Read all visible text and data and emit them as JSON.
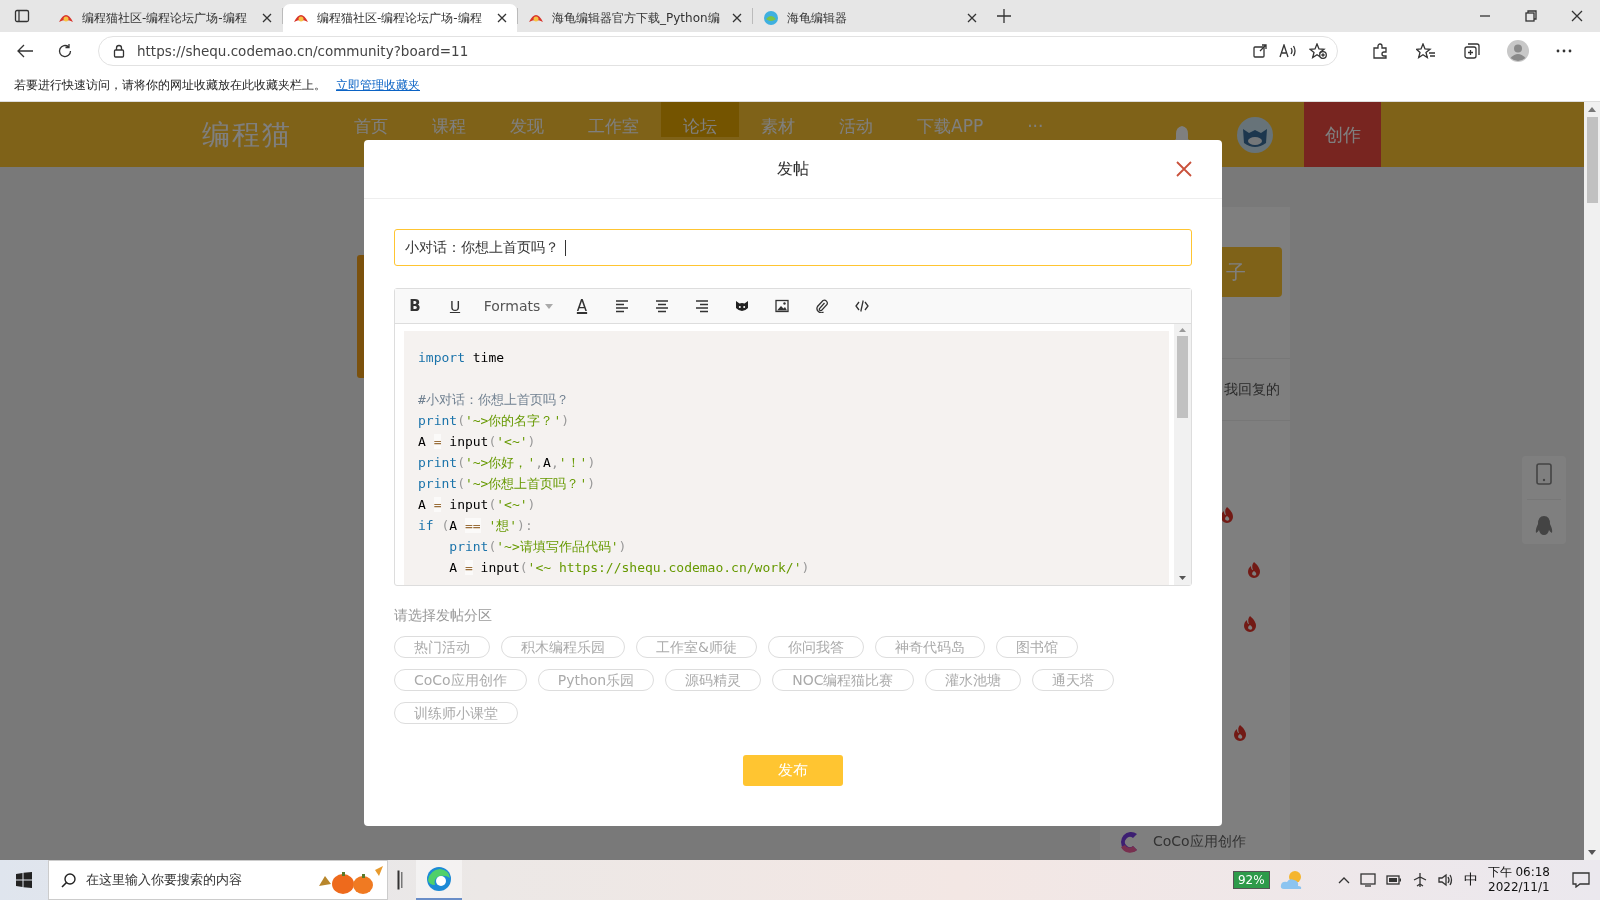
{
  "browser": {
    "tabs": [
      {
        "title": "编程猫社区-编程论坛广场-编程",
        "selected": false,
        "kind": "site"
      },
      {
        "title": "编程猫社区-编程论坛广场-编程",
        "selected": true,
        "kind": "site"
      },
      {
        "title": "海龟编辑器官方下载_Python编",
        "selected": false,
        "kind": "site"
      },
      {
        "title": "海龟编辑器",
        "selected": false,
        "kind": "turtle"
      }
    ],
    "address": "https://shequ.codemao.cn/community?board=11",
    "favorites_bar": {
      "message": "若要进行快速访问，请将你的网址收藏放在此收藏夹栏上。",
      "link": "立即管理收藏夹"
    }
  },
  "site": {
    "logo": "编程猫",
    "nav": [
      {
        "label": "首页",
        "selected": false
      },
      {
        "label": "课程",
        "selected": false
      },
      {
        "label": "发现",
        "selected": false
      },
      {
        "label": "工作室",
        "selected": false
      },
      {
        "label": "论坛",
        "selected": true
      },
      {
        "label": "素材",
        "selected": false
      },
      {
        "label": "活动",
        "selected": false
      },
      {
        "label": "下载APP",
        "selected": false
      },
      {
        "label": "···",
        "selected": false
      }
    ],
    "create_button": "创作",
    "sidebar": {
      "button": "子",
      "link": "我回复的",
      "coco": "CoCo应用创作"
    }
  },
  "dialog": {
    "title": "发帖",
    "title_input": {
      "value": "小对话：你想上首页吗？"
    },
    "toolbar": [
      {
        "kind": "bold",
        "label": "B"
      },
      {
        "kind": "underline",
        "label": "U"
      },
      {
        "kind": "formats",
        "label": "Formats"
      },
      {
        "kind": "color",
        "label": "A"
      },
      {
        "kind": "align-left"
      },
      {
        "kind": "align-center"
      },
      {
        "kind": "align-right"
      },
      {
        "kind": "cat"
      },
      {
        "kind": "image"
      },
      {
        "kind": "attach"
      },
      {
        "kind": "code"
      }
    ],
    "code_lines": [
      {
        "kind": "code",
        "tokens": [
          {
            "kind": "keyword",
            "text": "import"
          },
          {
            "kind": "plain",
            "text": " time"
          }
        ]
      },
      {
        "kind": "blank"
      },
      {
        "kind": "code",
        "tokens": [
          {
            "kind": "comment",
            "text": "#小对话：你想上首页吗？"
          }
        ]
      },
      {
        "kind": "code",
        "tokens": [
          {
            "kind": "keyword",
            "text": "print"
          },
          {
            "kind": "punct",
            "text": "("
          },
          {
            "kind": "string",
            "text": "'~>你的名字？'"
          },
          {
            "kind": "punct",
            "text": ")"
          }
        ]
      },
      {
        "kind": "code",
        "tokens": [
          {
            "kind": "plain",
            "text": "A "
          },
          {
            "kind": "operator",
            "text": "="
          },
          {
            "kind": "plain",
            "text": " input"
          },
          {
            "kind": "punct",
            "text": "("
          },
          {
            "kind": "string",
            "text": "'<~'"
          },
          {
            "kind": "punct",
            "text": ")"
          }
        ]
      },
      {
        "kind": "code",
        "tokens": [
          {
            "kind": "keyword",
            "text": "print"
          },
          {
            "kind": "punct",
            "text": "("
          },
          {
            "kind": "string",
            "text": "'~>你好，'"
          },
          {
            "kind": "punct",
            "text": ","
          },
          {
            "kind": "plain",
            "text": "A"
          },
          {
            "kind": "punct",
            "text": ","
          },
          {
            "kind": "string",
            "text": "'！'"
          },
          {
            "kind": "punct",
            "text": ")"
          }
        ]
      },
      {
        "kind": "code",
        "tokens": [
          {
            "kind": "keyword",
            "text": "print"
          },
          {
            "kind": "punct",
            "text": "("
          },
          {
            "kind": "string",
            "text": "'~>你想上首页吗？'"
          },
          {
            "kind": "punct",
            "text": ")"
          }
        ]
      },
      {
        "kind": "code",
        "tokens": [
          {
            "kind": "plain",
            "text": "A "
          },
          {
            "kind": "operator",
            "text": "="
          },
          {
            "kind": "plain",
            "text": " input"
          },
          {
            "kind": "punct",
            "text": "("
          },
          {
            "kind": "string",
            "text": "'<~'"
          },
          {
            "kind": "punct",
            "text": ")"
          }
        ]
      },
      {
        "kind": "code",
        "tokens": [
          {
            "kind": "keyword",
            "text": "if"
          },
          {
            "kind": "punct",
            "text": " ("
          },
          {
            "kind": "plain",
            "text": "A "
          },
          {
            "kind": "operator",
            "text": "=="
          },
          {
            "kind": "string",
            "text": " '想'"
          },
          {
            "kind": "punct",
            "text": "):"
          }
        ]
      },
      {
        "kind": "code",
        "tokens": [
          {
            "kind": "keyword",
            "text": "    print"
          },
          {
            "kind": "punct",
            "text": "("
          },
          {
            "kind": "string",
            "text": "'~>请填写作品代码'"
          },
          {
            "kind": "punct",
            "text": ")"
          }
        ]
      },
      {
        "kind": "code",
        "tokens": [
          {
            "kind": "plain",
            "text": "    A "
          },
          {
            "kind": "operator",
            "text": "="
          },
          {
            "kind": "plain",
            "text": " input"
          },
          {
            "kind": "punct",
            "text": "("
          },
          {
            "kind": "string",
            "text": "'<~ https://shequ.codemao.cn/work/'"
          },
          {
            "kind": "punct",
            "text": ")"
          }
        ]
      }
    ],
    "category_label": "请选择发帖分区",
    "categories": [
      "热门活动",
      "积木编程乐园",
      "工作室&师徒",
      "你问我答",
      "神奇代码岛",
      "图书馆",
      "CoCo应用创作",
      "Python乐园",
      "源码精灵",
      "NOC编程猫比赛",
      "灌水池塘",
      "通天塔",
      "训练师小课堂"
    ],
    "submit": "发布"
  },
  "taskbar": {
    "search_placeholder": "在这里输入你要搜索的内容",
    "battery": "92%",
    "ime": "中",
    "time": "下午 06:18",
    "date": "2022/11/1"
  }
}
